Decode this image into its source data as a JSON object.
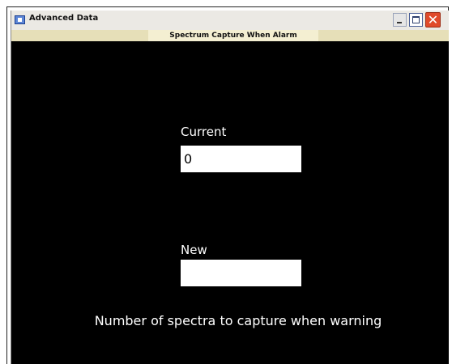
{
  "window": {
    "title": "Advanced Data",
    "close_glyph": "✕",
    "icons": {
      "app": "app-window-icon",
      "minimize": "minimize-icon",
      "maximize": "maximize-icon",
      "close": "close-icon"
    }
  },
  "header": {
    "title": "Spectrum Capture When Alarm"
  },
  "fields": {
    "current_label": "Current",
    "current_value": "0",
    "new_label": "New",
    "new_value": ""
  },
  "description": "Number of spectra to capture when warning",
  "colors": {
    "background": "#000000",
    "titlebar": "#ebe9e4",
    "subheader": "#e6dfb8",
    "close_button": "#e04a2a"
  }
}
